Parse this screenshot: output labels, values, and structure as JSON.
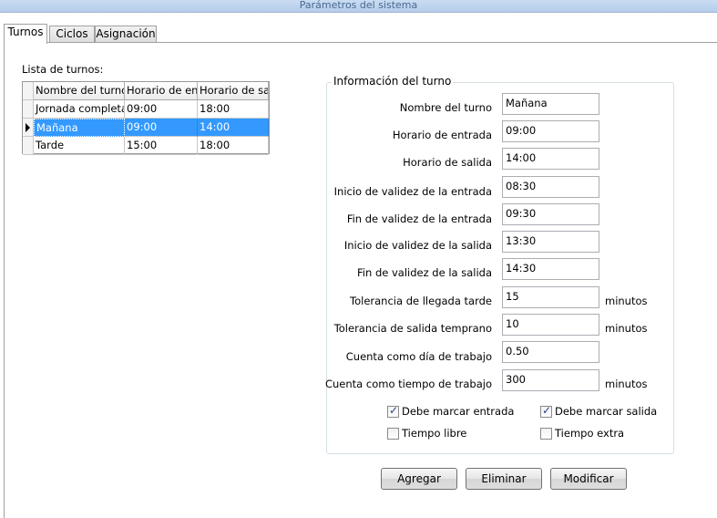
{
  "window": {
    "title": "Parámetros del sistema"
  },
  "tabs": [
    {
      "label": "Turnos",
      "active": true
    },
    {
      "label": "Ciclos",
      "active": false
    },
    {
      "label": "Asignación",
      "active": false
    }
  ],
  "shift_list": {
    "label": "Lista de turnos:",
    "columns": [
      "Nombre del turno",
      "Horario de ent",
      "Horario de sal"
    ],
    "rows": [
      {
        "name": "Jornada completa",
        "start": "09:00",
        "end": "18:00"
      },
      {
        "name": "Mañana",
        "start": "09:00",
        "end": "14:00",
        "selected": true
      },
      {
        "name": "Tarde",
        "start": "15:00",
        "end": "18:00"
      }
    ]
  },
  "shift_info": {
    "legend": "Información del turno",
    "fields": [
      {
        "label": "Nombre del turno",
        "value": "Mañana",
        "unit": ""
      },
      {
        "label": "Horario de entrada",
        "value": "09:00",
        "unit": ""
      },
      {
        "label": "Horario de salida",
        "value": "14:00",
        "unit": ""
      },
      {
        "label": "Inicio de validez de la entrada",
        "value": "08:30",
        "unit": ""
      },
      {
        "label": "Fin de validez de la entrada",
        "value": "09:30",
        "unit": ""
      },
      {
        "label": "Inicio de validez de la salida",
        "value": "13:30",
        "unit": ""
      },
      {
        "label": "Fin de validez de la salida",
        "value": "14:30",
        "unit": ""
      },
      {
        "label": "Tolerancia de llegada tarde",
        "value": "15",
        "unit": "minutos"
      },
      {
        "label": "Tolerancia de salida temprano",
        "value": "10",
        "unit": "minutos"
      },
      {
        "label": "Cuenta como día de trabajo",
        "value": "0.50",
        "unit": ""
      },
      {
        "label": "Cuenta como tiempo de trabajo",
        "value": "300",
        "unit": "minutos"
      }
    ],
    "checkboxes": [
      {
        "label": "Debe marcar entrada",
        "checked": true
      },
      {
        "label": "Debe marcar salida",
        "checked": true
      },
      {
        "label": "Tiempo libre",
        "checked": false
      },
      {
        "label": "Tiempo extra",
        "checked": false
      }
    ]
  },
  "actions": {
    "add": "Agregar",
    "delete": "Eliminar",
    "modify": "Modificar"
  },
  "colors": {
    "selection": "#3399ff",
    "title_bar": "#c9dcf2"
  }
}
